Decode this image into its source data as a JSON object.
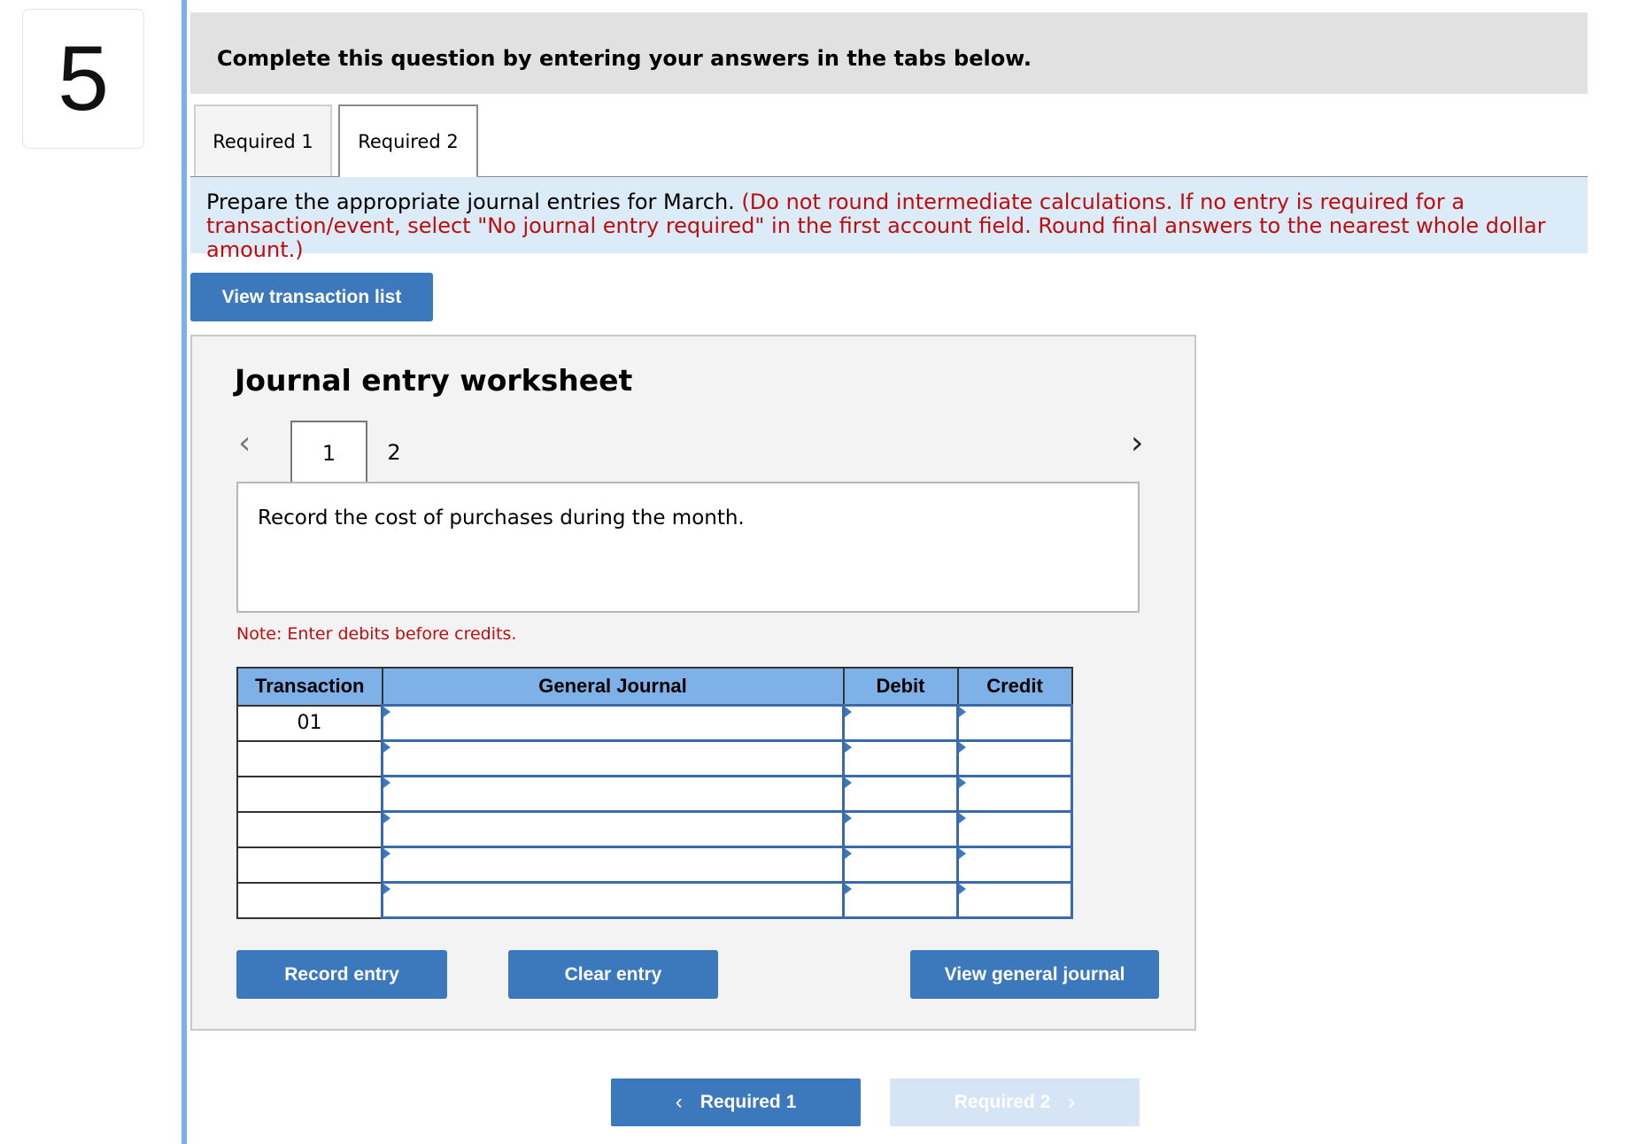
{
  "question": {
    "number": "5"
  },
  "header": {
    "text": "Complete this question by entering your answers in the tabs below."
  },
  "tabs": [
    {
      "label": "Required 1",
      "active": false
    },
    {
      "label": "Required 2",
      "active": true
    }
  ],
  "instructions": {
    "main": "Prepare the appropriate journal entries for March. ",
    "note": "(Do not round intermediate calculations. If no entry is required for a transaction/event, select \"No journal entry required\" in the first account field. Round final answers to the nearest whole dollar amount.)"
  },
  "view_transaction_list": "View transaction list",
  "worksheet": {
    "title": "Journal entry worksheet",
    "pages": [
      "1",
      "2"
    ],
    "current_page": "1",
    "description": "Record the cost of purchases during the month.",
    "note": "Note: Enter debits before credits.",
    "table": {
      "headers": [
        "Transaction",
        "General Journal",
        "Debit",
        "Credit"
      ],
      "rows": [
        {
          "transaction": "01",
          "account": "",
          "debit": "",
          "credit": ""
        },
        {
          "transaction": "",
          "account": "",
          "debit": "",
          "credit": ""
        },
        {
          "transaction": "",
          "account": "",
          "debit": "",
          "credit": ""
        },
        {
          "transaction": "",
          "account": "",
          "debit": "",
          "credit": ""
        },
        {
          "transaction": "",
          "account": "",
          "debit": "",
          "credit": ""
        },
        {
          "transaction": "",
          "account": "",
          "debit": "",
          "credit": ""
        }
      ]
    },
    "buttons": {
      "record": "Record entry",
      "clear": "Clear entry",
      "view_journal": "View general journal"
    }
  },
  "bottom_nav": {
    "prev": "Required 1",
    "next": "Required 2",
    "next_enabled": false
  },
  "colors": {
    "accent": "#3b78bc",
    "header_row": "#7db1e8",
    "instruction_bg": "#dcebf8",
    "red_text": "#bb0e0e",
    "disabled_button": "#d6e5f6"
  }
}
